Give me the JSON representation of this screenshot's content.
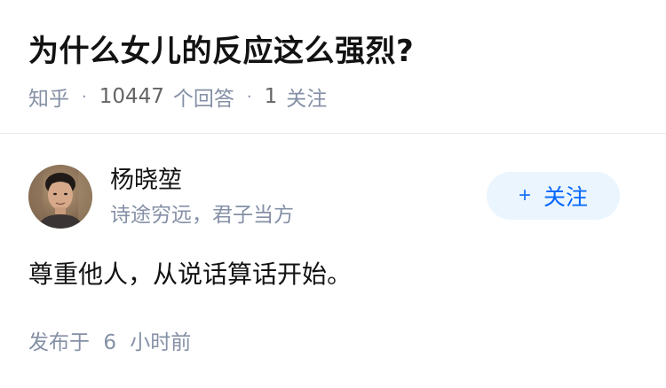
{
  "question": {
    "title": "为什么女儿的反应这么强烈?",
    "source": "知乎",
    "separator": "·",
    "answer_count": "10447",
    "answer_count_label": "个回答",
    "follower_count": "1",
    "follower_label": "关注"
  },
  "author": {
    "name": "杨晓堃",
    "bio": "诗途穷远，君子当方",
    "avatar_icon": "avatar-photo"
  },
  "follow_button": {
    "plus": "+",
    "label": "关注"
  },
  "answer": {
    "text": "尊重他人，从说话算话开始。"
  },
  "publish": {
    "prefix": "发布于",
    "value": "6",
    "unit": "小时前"
  },
  "colors": {
    "accent": "#0066ff",
    "follow_bg": "#ebf5fd",
    "meta": "#8590a6",
    "text": "#121212"
  }
}
